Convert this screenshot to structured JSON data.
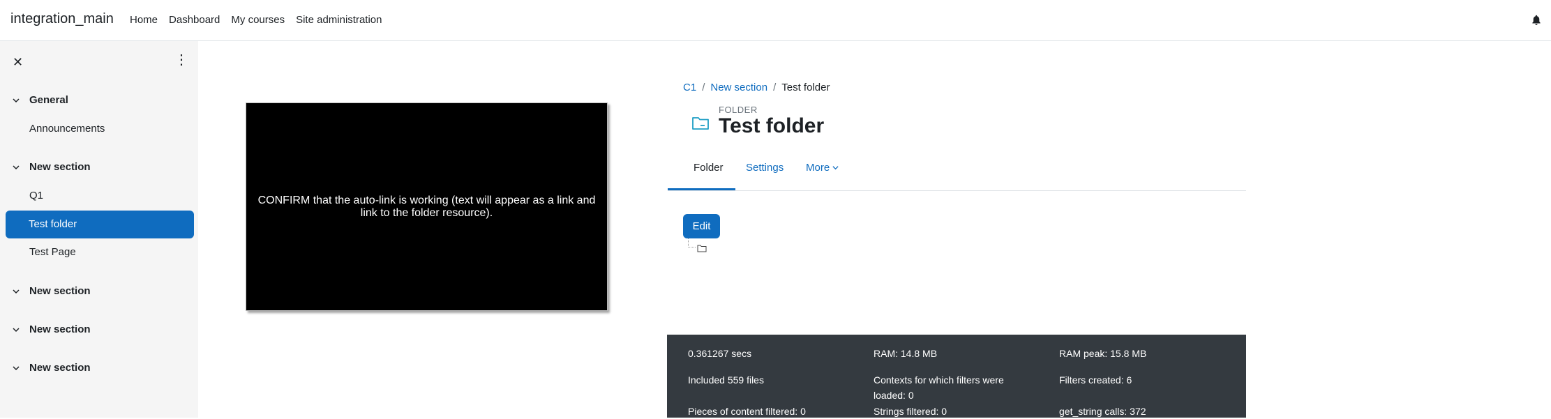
{
  "navbar": {
    "brand": "integration_main",
    "links": [
      "Home",
      "Dashboard",
      "My courses",
      "Site administration"
    ],
    "bell_icon": "bell-icon"
  },
  "drawer": {
    "close_icon": "close-icon",
    "menu_icon": "kebab-menu-icon",
    "sections": [
      {
        "label": "General",
        "items": [
          "Announcements"
        ]
      },
      {
        "label": "New section",
        "items": [
          "Q1",
          "Test folder",
          "Test Page"
        ]
      },
      {
        "label": "New section",
        "items": []
      },
      {
        "label": "New section",
        "items": []
      },
      {
        "label": "New section",
        "items": []
      }
    ],
    "active_item": "Test folder"
  },
  "media": {
    "text": "CONFIRM that the auto-link is working (text will appear as a link and link to the folder resource)."
  },
  "breadcrumb": {
    "items": [
      "C1",
      "New section"
    ],
    "current": "Test folder",
    "separator": "/"
  },
  "header": {
    "modtype": "FOLDER",
    "title": "Test folder",
    "icon": "folder-icon"
  },
  "tabs": {
    "folder": "Folder",
    "settings": "Settings",
    "more": "More"
  },
  "content": {
    "edit_label": "Edit"
  },
  "footer": {
    "time": "0.361267 secs",
    "ram": "RAM: 14.8 MB",
    "ram_peak": "RAM peak: 15.8 MB",
    "included": "Included 559 files",
    "contexts_line1": "Contexts for which filters were",
    "contexts_line2": "loaded: 0",
    "filters_created": "Filters created: 6",
    "pieces": "Pieces of content filtered: 0",
    "strings": "Strings filtered: 0",
    "get_string": "get_string calls: 372"
  },
  "colors": {
    "accent": "#0f6cbf",
    "footer_bg": "#343a40",
    "drawer_bg": "#f5f5f5"
  }
}
